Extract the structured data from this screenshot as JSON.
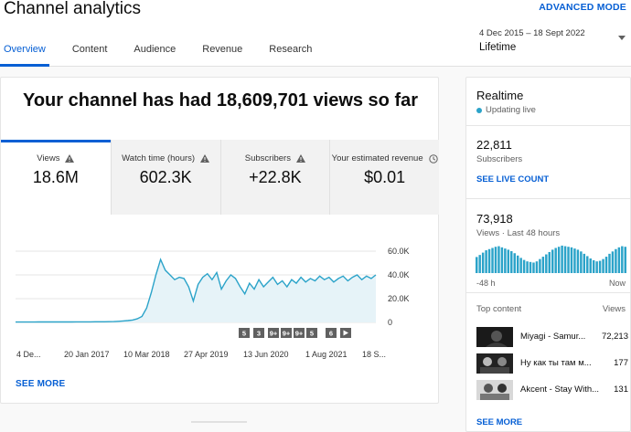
{
  "header": {
    "title": "Channel analytics",
    "advanced_mode": "ADVANCED MODE",
    "tabs": [
      {
        "label": "Overview",
        "active": true
      },
      {
        "label": "Content",
        "active": false
      },
      {
        "label": "Audience",
        "active": false
      },
      {
        "label": "Revenue",
        "active": false
      },
      {
        "label": "Research",
        "active": false
      }
    ],
    "date_range": {
      "range": "4 Dec 2015 – 18 Sept 2022",
      "period": "Lifetime"
    }
  },
  "main": {
    "headline": "Your channel has had 18,609,701 views so far",
    "metrics": [
      {
        "label": "Views",
        "value": "18.6M",
        "icon": "warning-icon",
        "active": true
      },
      {
        "label": "Watch time (hours)",
        "value": "602.3K",
        "icon": "warning-icon",
        "active": false
      },
      {
        "label": "Subscribers",
        "value": "+22.8K",
        "icon": "warning-icon",
        "active": false
      },
      {
        "label": "Your estimated revenue",
        "value": "$0.01",
        "icon": "clock-icon",
        "active": false
      }
    ],
    "see_more": "SEE MORE"
  },
  "chart_data": {
    "type": "area",
    "title": "",
    "xlabel": "",
    "ylabel": "",
    "x_tick_labels": [
      "4 De...",
      "20 Jan 2017",
      "10 Mar 2018",
      "27 Apr 2019",
      "13 Jun 2020",
      "1 Aug 2021",
      "18 S..."
    ],
    "y_tick_labels": [
      "0",
      "20.0K",
      "40.0K",
      "60.0K"
    ],
    "ylim": [
      0,
      60000
    ],
    "grid": true,
    "color": "#2ba3c9",
    "series": [
      {
        "values": [
          300,
          320,
          310,
          340,
          330,
          360,
          350,
          380,
          370,
          400,
          390,
          420,
          410,
          450,
          440,
          480,
          470,
          500,
          520,
          560,
          600,
          700,
          900,
          1200,
          1500,
          2000,
          3000,
          5000,
          12000,
          25000,
          40000,
          53000,
          44000,
          40000,
          36000,
          38000,
          37000,
          30000,
          18000,
          32000,
          38000,
          41000,
          36000,
          42000,
          28000,
          35000,
          40000,
          37000,
          30000,
          24000,
          33000,
          28000,
          36000,
          30000,
          34000,
          38000,
          32000,
          35000,
          30000,
          36000,
          33000,
          38000,
          34000,
          37000,
          35000,
          39000,
          36000,
          38000,
          34000,
          37000,
          39000,
          35000,
          38000,
          40000,
          36000,
          39000,
          37000,
          40000
        ]
      }
    ],
    "markers": [
      "5",
      "3",
      "9+",
      "9+",
      "9+",
      "5",
      "6",
      "play"
    ]
  },
  "realtime": {
    "title": "Realtime",
    "status": "Updating live",
    "subscribers_value": "22,811",
    "subscribers_label": "Subscribers",
    "see_live_count": "SEE LIVE COUNT",
    "views_value": "73,918",
    "views_label": "Views · Last 48 hours",
    "bar_levels": [
      0.55,
      0.62,
      0.7,
      0.78,
      0.82,
      0.86,
      0.9,
      0.92,
      0.88,
      0.84,
      0.8,
      0.75,
      0.68,
      0.6,
      0.52,
      0.45,
      0.4,
      0.38,
      0.36,
      0.4,
      0.48,
      0.56,
      0.64,
      0.72,
      0.8,
      0.86,
      0.9,
      0.94,
      0.92,
      0.9,
      0.88,
      0.84,
      0.8,
      0.74,
      0.66,
      0.58,
      0.5,
      0.44,
      0.4,
      0.42,
      0.48,
      0.56,
      0.66,
      0.74,
      0.82,
      0.88,
      0.92,
      0.9
    ],
    "axis_start": "-48 h",
    "axis_end": "Now",
    "top_content_label": "Top content",
    "views_col_label": "Views",
    "videos": [
      {
        "title": "Miyagi - Samur...",
        "views": "72,213"
      },
      {
        "title": "Ну как ты там м...",
        "views": "177"
      },
      {
        "title": "Akcent - Stay With...",
        "views": "131"
      }
    ],
    "see_more": "SEE MORE"
  }
}
